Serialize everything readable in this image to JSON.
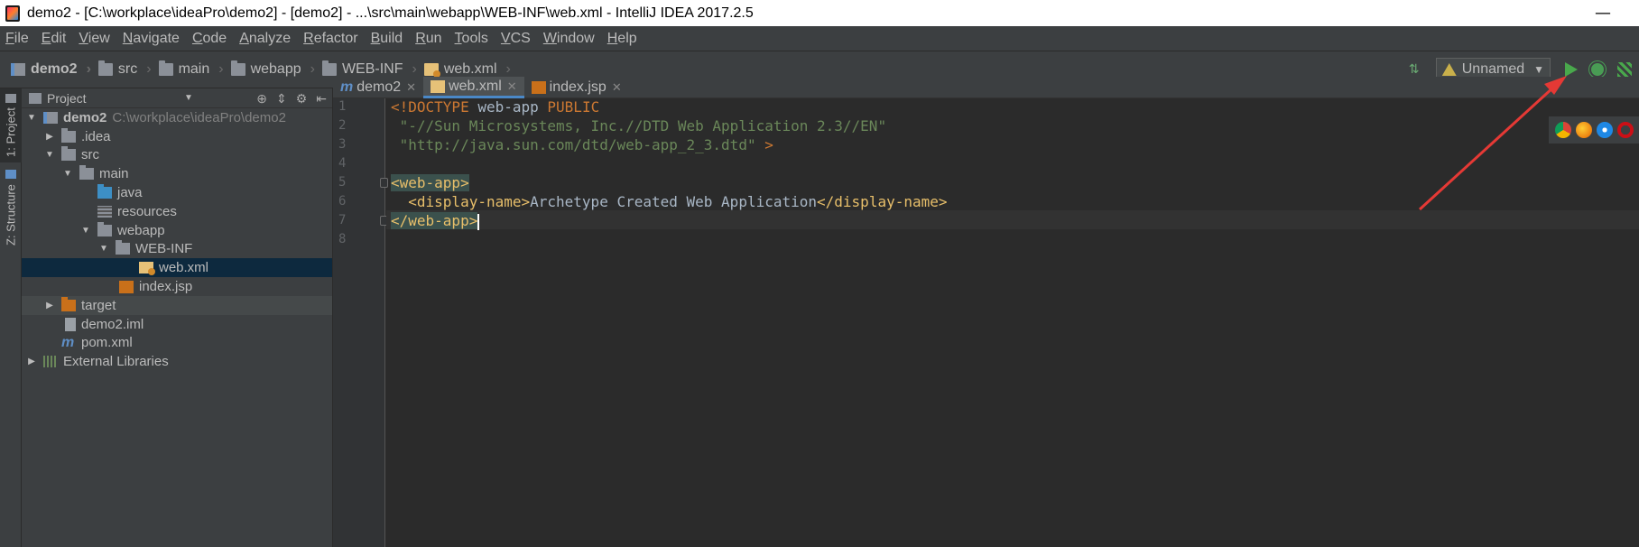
{
  "window": {
    "title": "demo2 - [C:\\workplace\\ideaPro\\demo2] - [demo2] - ...\\src\\main\\webapp\\WEB-INF\\web.xml - IntelliJ IDEA 2017.2.5",
    "minimize": "—"
  },
  "menu": [
    "File",
    "Edit",
    "View",
    "Navigate",
    "Code",
    "Analyze",
    "Refactor",
    "Build",
    "Run",
    "Tools",
    "VCS",
    "Window",
    "Help"
  ],
  "breadcrumbs": [
    {
      "label": "demo2",
      "icon": "module-icon"
    },
    {
      "label": "src",
      "icon": "folder-icon"
    },
    {
      "label": "main",
      "icon": "folder-icon"
    },
    {
      "label": "webapp",
      "icon": "folder-icon"
    },
    {
      "label": "WEB-INF",
      "icon": "folder-icon"
    },
    {
      "label": "web.xml",
      "icon": "xml-file-icon"
    }
  ],
  "toolbar": {
    "run_config": "Unnamed"
  },
  "side_tabs": {
    "project": "1: Project",
    "structure": "Z: Structure"
  },
  "project_panel": {
    "title": "Project",
    "tree": [
      {
        "label": "demo2",
        "path": "C:\\workplace\\ideaPro\\demo2"
      },
      {
        "label": ".idea"
      },
      {
        "label": "src"
      },
      {
        "label": "main"
      },
      {
        "label": "java"
      },
      {
        "label": "resources"
      },
      {
        "label": "webapp"
      },
      {
        "label": "WEB-INF"
      },
      {
        "label": "web.xml"
      },
      {
        "label": "index.jsp"
      },
      {
        "label": "target"
      },
      {
        "label": "demo2.iml"
      },
      {
        "label": "pom.xml"
      },
      {
        "label": "External Libraries"
      }
    ]
  },
  "tabs": [
    {
      "label": "demo2",
      "icon": "maven-icon"
    },
    {
      "label": "web.xml",
      "icon": "xml-file-icon",
      "active": true
    },
    {
      "label": "index.jsp",
      "icon": "jsp-file-icon"
    }
  ],
  "editor": {
    "line_numbers": [
      "1",
      "2",
      "3",
      "4",
      "5",
      "6",
      "7",
      "8"
    ],
    "lines": {
      "l1a": "<!DOCTYPE",
      "l1b": " web-app ",
      "l1c": "PUBLIC",
      "l2": " \"-//Sun Microsystems, Inc.//DTD Web Application 2.3//EN\"",
      "l3a": " \"http://java.sun.com/dtd/web-app_2_3.dtd\"",
      "l3b": " >",
      "l5": "<web-app>",
      "l6a": "  <display-name>",
      "l6b": "Archetype Created Web Application",
      "l6c": "</display-name>",
      "l7": "</web-app>"
    }
  },
  "colors": {
    "annotation_arrow": "#e53935",
    "run_green": "#49a84c",
    "selection_blue": "#0d293e"
  }
}
